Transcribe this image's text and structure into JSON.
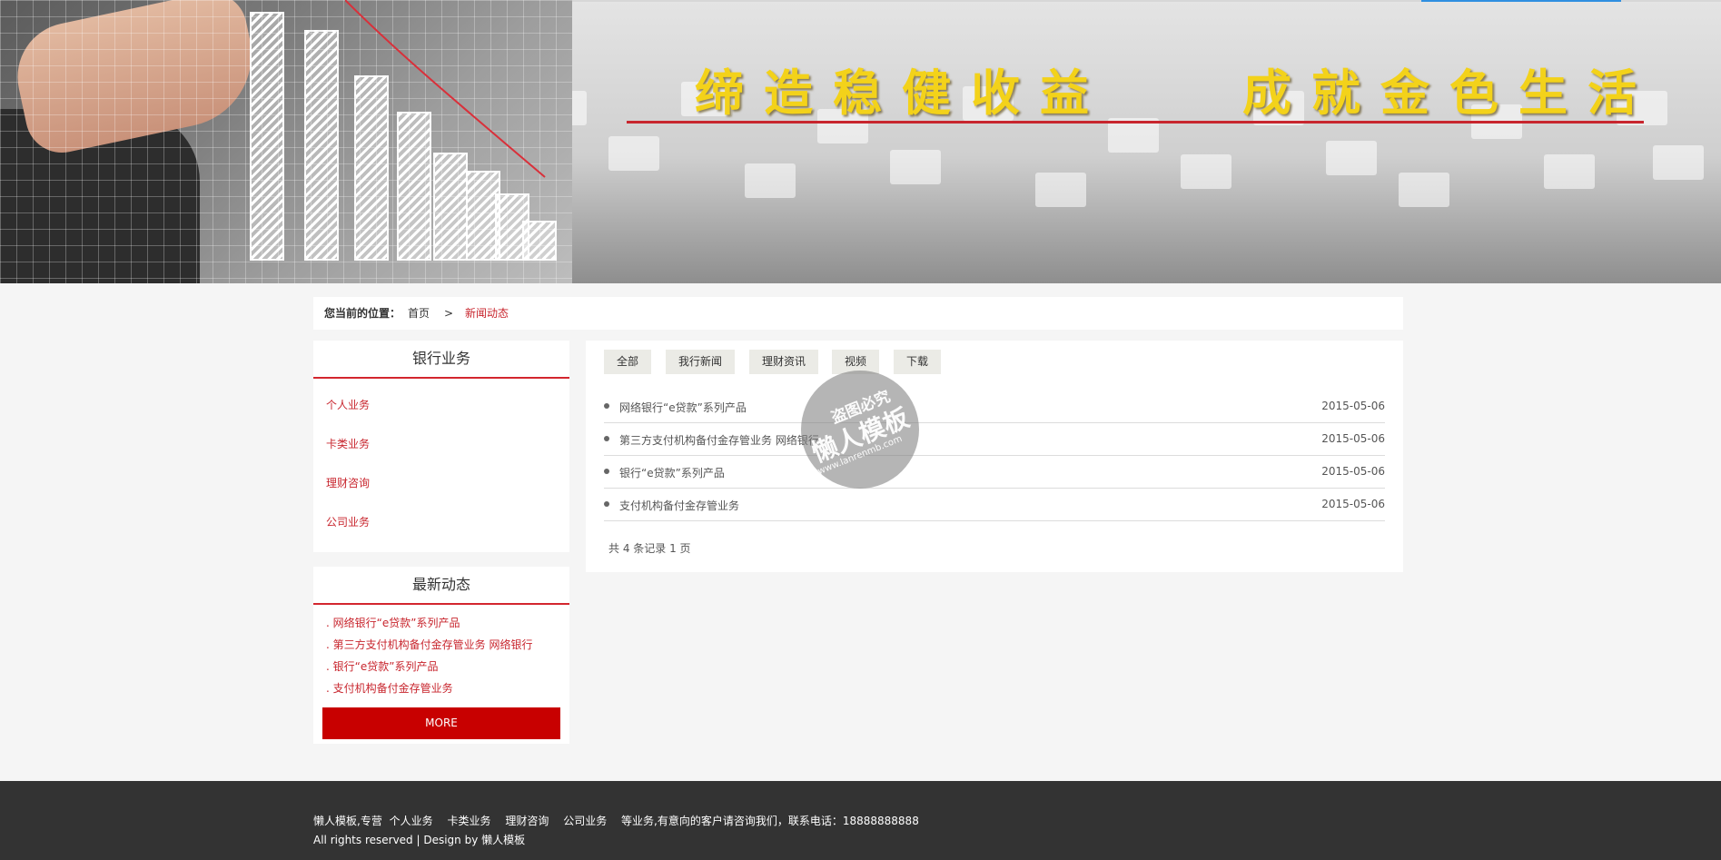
{
  "banner": {
    "slogan_left": "缔造稳健收益",
    "slogan_right": "成就金色生活"
  },
  "breadcrumb": {
    "label": "您当前的位置：",
    "home": "首页",
    "separator": ">",
    "current": "新闻动态"
  },
  "sidebar": {
    "category_title": "银行业务",
    "categories": [
      "个人业务",
      "卡类业务",
      "理财咨询",
      "公司业务"
    ],
    "news_title": "最新动态",
    "news": [
      ". 网络银行“e贷款”系列产品",
      ". 第三方支付机构备付金存管业务 网络银行",
      ". 银行“e贷款”系列产品",
      ". 支付机构备付金存管业务"
    ],
    "more_label": "MORE"
  },
  "tabs": [
    "全部",
    "我行新闻",
    "理财资讯",
    "视频",
    "下载"
  ],
  "articles": [
    {
      "title": "网络银行“e贷款”系列产品",
      "date": "2015-05-06"
    },
    {
      "title": "第三方支付机构备付金存管业务 网络银行",
      "date": "2015-05-06"
    },
    {
      "title": "银行“e贷款”系列产品",
      "date": "2015-05-06"
    },
    {
      "title": "支付机构备付金存管业务",
      "date": "2015-05-06"
    }
  ],
  "pager": "共 4 条记录 1 页",
  "watermark": {
    "line1": "盗图必究",
    "line2": "懒人模板",
    "line3": "www.lanrenmb.com"
  },
  "footer": {
    "prefix": "懒人模板,专营",
    "links": [
      "个人业务",
      "卡类业务",
      "理财咨询",
      "公司业务"
    ],
    "suffix": "等业务,有意向的客户请咨询我们，联系电话：18888888888",
    "copyright": "All rights reserved | Design by 懒人模板"
  },
  "colors": {
    "accent": "#c8262e",
    "button": "#c80000",
    "footer_bg": "#333333",
    "slogan": "#f3d21a"
  }
}
